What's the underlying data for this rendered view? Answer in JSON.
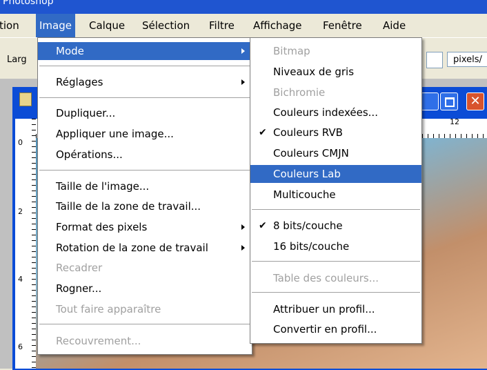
{
  "window": {
    "title": "Photoshop"
  },
  "menubar": {
    "items": [
      {
        "label": "tion"
      },
      {
        "label": "Image",
        "active": true
      },
      {
        "label": "Calque"
      },
      {
        "label": "Sélection"
      },
      {
        "label": "Filtre"
      },
      {
        "label": "Affichage"
      },
      {
        "label": "Fenêtre"
      },
      {
        "label": "Aide"
      }
    ]
  },
  "options_bar": {
    "width_label": "Larg",
    "units": "pixels/"
  },
  "rulers": {
    "left_ticks": [
      "0",
      "2",
      "4",
      "6"
    ],
    "top_ticks": [
      "12"
    ]
  },
  "image_menu": {
    "items": [
      {
        "label": "Mode",
        "submenu": true,
        "highlighted": true
      },
      {
        "label": "Réglages",
        "submenu": true
      },
      {
        "label": "Dupliquer..."
      },
      {
        "label": "Appliquer une image..."
      },
      {
        "label": "Opérations..."
      },
      {
        "label": "Taille de l'image..."
      },
      {
        "label": "Taille de la zone de travail..."
      },
      {
        "label": "Format des pixels",
        "submenu": true
      },
      {
        "label": "Rotation de la zone de travail",
        "submenu": true
      },
      {
        "label": "Recadrer",
        "disabled": true
      },
      {
        "label": "Rogner..."
      },
      {
        "label": "Tout faire apparaître",
        "disabled": true
      },
      {
        "label": "Recouvrement...",
        "disabled": true
      }
    ]
  },
  "mode_menu": {
    "items": [
      {
        "label": "Bitmap",
        "disabled": true
      },
      {
        "label": "Niveaux de gris"
      },
      {
        "label": "Bichromie",
        "disabled": true
      },
      {
        "label": "Couleurs indexées..."
      },
      {
        "label": "Couleurs RVB",
        "checked": true
      },
      {
        "label": "Couleurs CMJN"
      },
      {
        "label": "Couleurs Lab",
        "highlighted": true
      },
      {
        "label": "Multicouche"
      },
      {
        "label": "8 bits/couche",
        "checked": true
      },
      {
        "label": "16 bits/couche"
      },
      {
        "label": "Table des couleurs...",
        "disabled": true
      },
      {
        "label": "Attribuer un profil..."
      },
      {
        "label": "Convertir en profil..."
      }
    ]
  },
  "colors": {
    "highlight": "#316ac5",
    "menubar": "#ece9d8",
    "disabled_text": "#a0a0a0",
    "close_button": "#d8532d"
  }
}
